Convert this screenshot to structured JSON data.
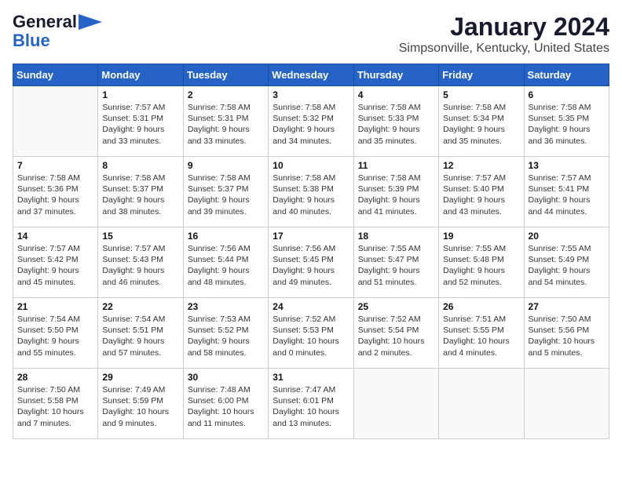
{
  "header": {
    "logo_line1": "General",
    "logo_line2": "Blue",
    "month_title": "January 2024",
    "location": "Simpsonville, Kentucky, United States"
  },
  "weekdays": [
    "Sunday",
    "Monday",
    "Tuesday",
    "Wednesday",
    "Thursday",
    "Friday",
    "Saturday"
  ],
  "weeks": [
    [
      {
        "day": "",
        "sunrise": "",
        "sunset": "",
        "daylight": ""
      },
      {
        "day": "1",
        "sunrise": "Sunrise: 7:57 AM",
        "sunset": "Sunset: 5:31 PM",
        "daylight": "Daylight: 9 hours and 33 minutes."
      },
      {
        "day": "2",
        "sunrise": "Sunrise: 7:58 AM",
        "sunset": "Sunset: 5:31 PM",
        "daylight": "Daylight: 9 hours and 33 minutes."
      },
      {
        "day": "3",
        "sunrise": "Sunrise: 7:58 AM",
        "sunset": "Sunset: 5:32 PM",
        "daylight": "Daylight: 9 hours and 34 minutes."
      },
      {
        "day": "4",
        "sunrise": "Sunrise: 7:58 AM",
        "sunset": "Sunset: 5:33 PM",
        "daylight": "Daylight: 9 hours and 35 minutes."
      },
      {
        "day": "5",
        "sunrise": "Sunrise: 7:58 AM",
        "sunset": "Sunset: 5:34 PM",
        "daylight": "Daylight: 9 hours and 35 minutes."
      },
      {
        "day": "6",
        "sunrise": "Sunrise: 7:58 AM",
        "sunset": "Sunset: 5:35 PM",
        "daylight": "Daylight: 9 hours and 36 minutes."
      }
    ],
    [
      {
        "day": "7",
        "sunrise": "Sunrise: 7:58 AM",
        "sunset": "Sunset: 5:36 PM",
        "daylight": "Daylight: 9 hours and 37 minutes."
      },
      {
        "day": "8",
        "sunrise": "Sunrise: 7:58 AM",
        "sunset": "Sunset: 5:37 PM",
        "daylight": "Daylight: 9 hours and 38 minutes."
      },
      {
        "day": "9",
        "sunrise": "Sunrise: 7:58 AM",
        "sunset": "Sunset: 5:37 PM",
        "daylight": "Daylight: 9 hours and 39 minutes."
      },
      {
        "day": "10",
        "sunrise": "Sunrise: 7:58 AM",
        "sunset": "Sunset: 5:38 PM",
        "daylight": "Daylight: 9 hours and 40 minutes."
      },
      {
        "day": "11",
        "sunrise": "Sunrise: 7:58 AM",
        "sunset": "Sunset: 5:39 PM",
        "daylight": "Daylight: 9 hours and 41 minutes."
      },
      {
        "day": "12",
        "sunrise": "Sunrise: 7:57 AM",
        "sunset": "Sunset: 5:40 PM",
        "daylight": "Daylight: 9 hours and 43 minutes."
      },
      {
        "day": "13",
        "sunrise": "Sunrise: 7:57 AM",
        "sunset": "Sunset: 5:41 PM",
        "daylight": "Daylight: 9 hours and 44 minutes."
      }
    ],
    [
      {
        "day": "14",
        "sunrise": "Sunrise: 7:57 AM",
        "sunset": "Sunset: 5:42 PM",
        "daylight": "Daylight: 9 hours and 45 minutes."
      },
      {
        "day": "15",
        "sunrise": "Sunrise: 7:57 AM",
        "sunset": "Sunset: 5:43 PM",
        "daylight": "Daylight: 9 hours and 46 minutes."
      },
      {
        "day": "16",
        "sunrise": "Sunrise: 7:56 AM",
        "sunset": "Sunset: 5:44 PM",
        "daylight": "Daylight: 9 hours and 48 minutes."
      },
      {
        "day": "17",
        "sunrise": "Sunrise: 7:56 AM",
        "sunset": "Sunset: 5:45 PM",
        "daylight": "Daylight: 9 hours and 49 minutes."
      },
      {
        "day": "18",
        "sunrise": "Sunrise: 7:55 AM",
        "sunset": "Sunset: 5:47 PM",
        "daylight": "Daylight: 9 hours and 51 minutes."
      },
      {
        "day": "19",
        "sunrise": "Sunrise: 7:55 AM",
        "sunset": "Sunset: 5:48 PM",
        "daylight": "Daylight: 9 hours and 52 minutes."
      },
      {
        "day": "20",
        "sunrise": "Sunrise: 7:55 AM",
        "sunset": "Sunset: 5:49 PM",
        "daylight": "Daylight: 9 hours and 54 minutes."
      }
    ],
    [
      {
        "day": "21",
        "sunrise": "Sunrise: 7:54 AM",
        "sunset": "Sunset: 5:50 PM",
        "daylight": "Daylight: 9 hours and 55 minutes."
      },
      {
        "day": "22",
        "sunrise": "Sunrise: 7:54 AM",
        "sunset": "Sunset: 5:51 PM",
        "daylight": "Daylight: 9 hours and 57 minutes."
      },
      {
        "day": "23",
        "sunrise": "Sunrise: 7:53 AM",
        "sunset": "Sunset: 5:52 PM",
        "daylight": "Daylight: 9 hours and 58 minutes."
      },
      {
        "day": "24",
        "sunrise": "Sunrise: 7:52 AM",
        "sunset": "Sunset: 5:53 PM",
        "daylight": "Daylight: 10 hours and 0 minutes."
      },
      {
        "day": "25",
        "sunrise": "Sunrise: 7:52 AM",
        "sunset": "Sunset: 5:54 PM",
        "daylight": "Daylight: 10 hours and 2 minutes."
      },
      {
        "day": "26",
        "sunrise": "Sunrise: 7:51 AM",
        "sunset": "Sunset: 5:55 PM",
        "daylight": "Daylight: 10 hours and 4 minutes."
      },
      {
        "day": "27",
        "sunrise": "Sunrise: 7:50 AM",
        "sunset": "Sunset: 5:56 PM",
        "daylight": "Daylight: 10 hours and 5 minutes."
      }
    ],
    [
      {
        "day": "28",
        "sunrise": "Sunrise: 7:50 AM",
        "sunset": "Sunset: 5:58 PM",
        "daylight": "Daylight: 10 hours and 7 minutes."
      },
      {
        "day": "29",
        "sunrise": "Sunrise: 7:49 AM",
        "sunset": "Sunset: 5:59 PM",
        "daylight": "Daylight: 10 hours and 9 minutes."
      },
      {
        "day": "30",
        "sunrise": "Sunrise: 7:48 AM",
        "sunset": "Sunset: 6:00 PM",
        "daylight": "Daylight: 10 hours and 11 minutes."
      },
      {
        "day": "31",
        "sunrise": "Sunrise: 7:47 AM",
        "sunset": "Sunset: 6:01 PM",
        "daylight": "Daylight: 10 hours and 13 minutes."
      },
      {
        "day": "",
        "sunrise": "",
        "sunset": "",
        "daylight": ""
      },
      {
        "day": "",
        "sunrise": "",
        "sunset": "",
        "daylight": ""
      },
      {
        "day": "",
        "sunrise": "",
        "sunset": "",
        "daylight": ""
      }
    ]
  ]
}
